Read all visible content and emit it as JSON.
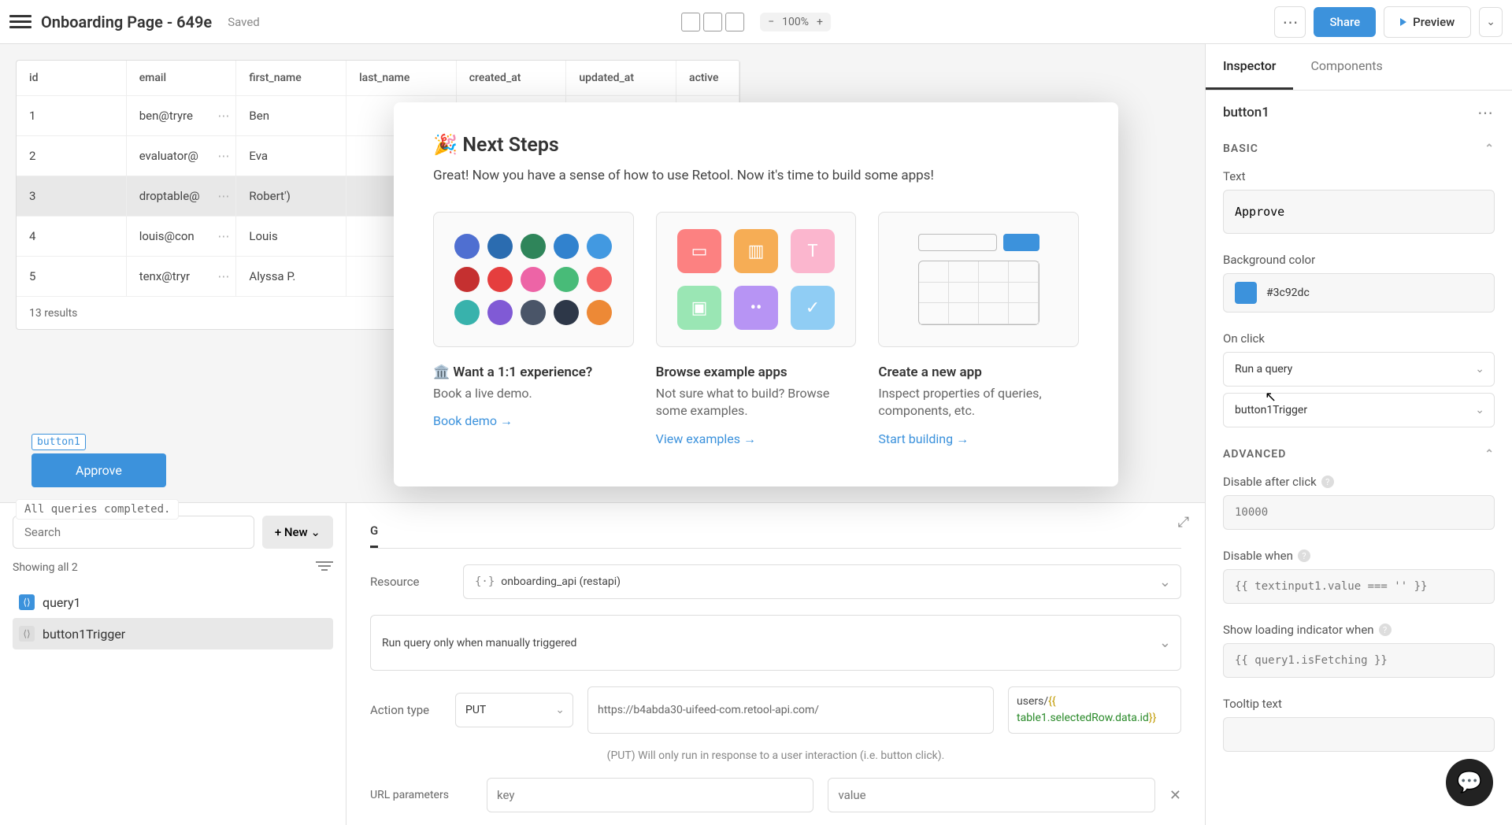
{
  "topbar": {
    "page_title": "Onboarding Page - 649e",
    "saved": "Saved",
    "zoom": "100%",
    "share": "Share",
    "preview": "Preview"
  },
  "table": {
    "headers": [
      "id",
      "email",
      "first_name",
      "last_name",
      "created_at",
      "updated_at",
      "active"
    ],
    "rows": [
      {
        "id": "1",
        "email": "ben@tryre",
        "first_name": "Ben"
      },
      {
        "id": "2",
        "email": "evaluator@",
        "first_name": "Eva"
      },
      {
        "id": "3",
        "email": "droptable@",
        "first_name": "Robert')"
      },
      {
        "id": "4",
        "email": "louis@con",
        "first_name": "Louis"
      },
      {
        "id": "5",
        "email": "tenx@tryr",
        "first_name": "Alyssa P."
      }
    ],
    "footer": "13 results"
  },
  "canvas": {
    "component_label": "button1",
    "approve": "Approve",
    "status": "All queries completed."
  },
  "bottom": {
    "search_placeholder": "Search",
    "new_btn": "+ New",
    "showing": "Showing all 2",
    "queries": [
      "query1",
      "button1Trigger"
    ],
    "tab_general": "G",
    "resource_label": "Resource",
    "resource_value": "onboarding_api (restapi)",
    "trigger_mode": "Run query only when manually triggered",
    "action_type_label": "Action type",
    "action_type_value": "PUT",
    "url_base": "https://b4abda30-uifeed-com.retool-api.com/",
    "url_path_prefix": "users/",
    "url_template_var": "table1.selectedRow.data.id",
    "hint": "(PUT) Will only run in response to a user interaction (i.e. button click).",
    "params_label": "URL parameters",
    "param_key_placeholder": "key",
    "param_value_placeholder": "value"
  },
  "inspector": {
    "tabs": [
      "Inspector",
      "Components"
    ],
    "component": "button1",
    "section_basic": "BASIC",
    "text_label": "Text",
    "text_value": "Approve",
    "bg_label": "Background color",
    "bg_value": "#3c92dc",
    "onclick_label": "On click",
    "onclick_action": "Run a query",
    "onclick_query": "button1Trigger",
    "section_advanced": "ADVANCED",
    "disable_after_label": "Disable after click",
    "disable_after_placeholder": "10000",
    "disable_when_label": "Disable when",
    "disable_when_placeholder": "{{ textinput1.value === '' }}",
    "loading_label": "Show loading indicator when",
    "loading_placeholder": "{{ query1.isFetching }}",
    "tooltip_label": "Tooltip text"
  },
  "modal": {
    "title": "🎉 Next Steps",
    "subtitle": "Great! Now you have a sense of how to use Retool. Now it's time to build some apps!",
    "cards": [
      {
        "title": "🏛️ Want a 1:1 experience?",
        "desc": "Book a live demo.",
        "link": "Book demo →"
      },
      {
        "title": "Browse example apps",
        "desc": "Not sure what to build? Browse some examples.",
        "link": "View examples →"
      },
      {
        "title": "Create a new app",
        "desc": "Inspect properties of queries, components, etc.",
        "link": "Start building →"
      }
    ]
  }
}
